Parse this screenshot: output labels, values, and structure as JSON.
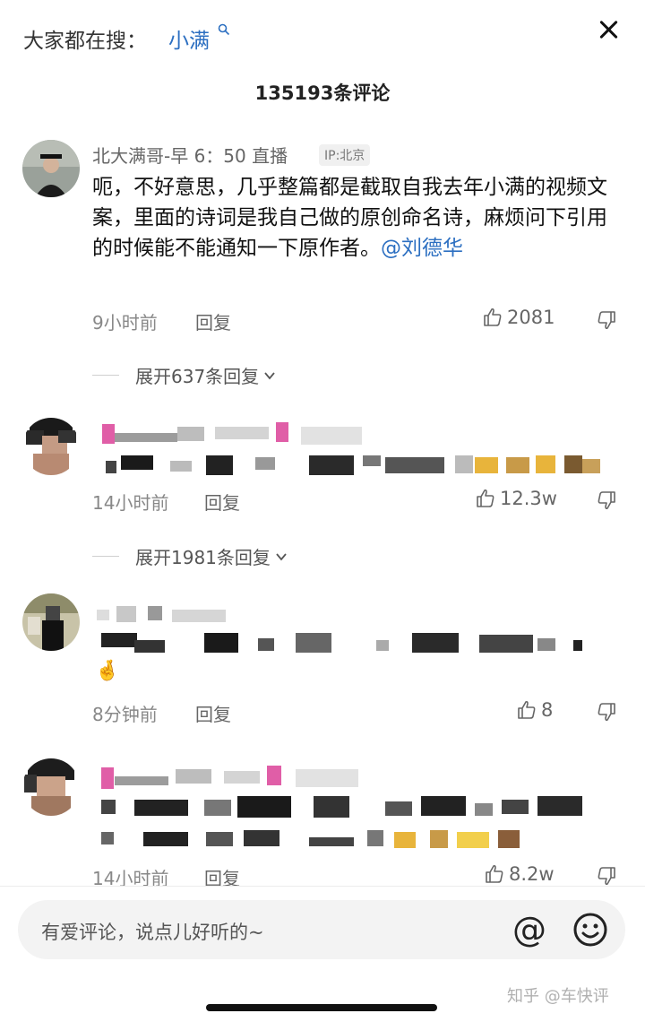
{
  "search": {
    "prefix": "大家都在搜：",
    "term": "小满",
    "icon": "search-icon"
  },
  "header": {
    "comment_count_title": "135193条评论",
    "close_icon": "close-icon"
  },
  "comments": [
    {
      "username": "北大满哥-早 6：50 直播",
      "ip": "IP:北京",
      "text": "呃，不好意思，几乎整篇都是截取自我去年小满的视频文案，里面的诗词是我自己做的原创命名诗，麻烦问下引用的时候能不能通知一下原作者。",
      "mention": "@刘德华",
      "time": "9小时前",
      "reply": "回复",
      "likes": "2081"
    },
    {
      "time": "14小时前",
      "reply": "回复",
      "likes": "12.3w"
    },
    {
      "time": "8分钟前",
      "reply": "回复",
      "likes": "8",
      "emoji": "🤞"
    },
    {
      "time": "14小时前",
      "reply": "回复",
      "likes": "8.2w"
    }
  ],
  "expand": [
    {
      "label": "展开637条回复"
    },
    {
      "label": "展开1981条回复"
    }
  ],
  "input": {
    "placeholder": "有爱评论，说点儿好听的~",
    "at_symbol": "@"
  },
  "watermark": "知乎 @车快评",
  "colors": {
    "link": "#2c6fc1",
    "text": "#111111",
    "muted": "#888888"
  }
}
